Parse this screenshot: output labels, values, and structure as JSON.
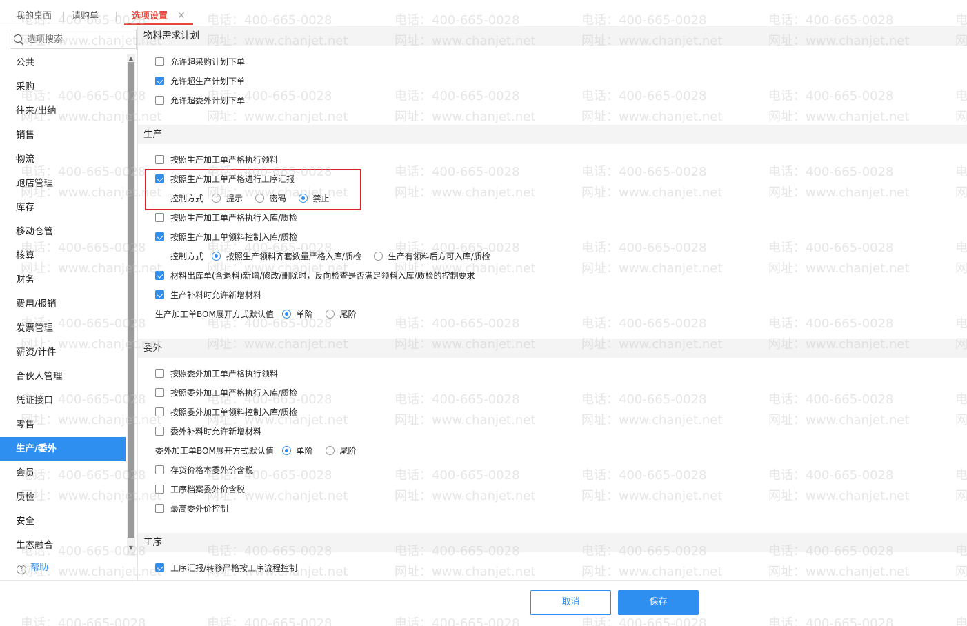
{
  "tabs": [
    {
      "label": "我的桌面"
    },
    {
      "label": "请购单"
    },
    {
      "label": "选项设置"
    }
  ],
  "colors": {
    "accent": "#2f8ff0",
    "active_tab": "#e8453c",
    "highlight_border": "#d9232c"
  },
  "sidebar": {
    "search_placeholder": "选项搜索",
    "items": [
      {
        "label": "公共"
      },
      {
        "label": "采购"
      },
      {
        "label": "往来/出纳"
      },
      {
        "label": "销售"
      },
      {
        "label": "物流"
      },
      {
        "label": "跑店管理"
      },
      {
        "label": "库存"
      },
      {
        "label": "移动仓管"
      },
      {
        "label": "核算"
      },
      {
        "label": "财务"
      },
      {
        "label": "费用/报销"
      },
      {
        "label": "发票管理"
      },
      {
        "label": "薪资/计件"
      },
      {
        "label": "合伙人管理"
      },
      {
        "label": "凭证接口"
      },
      {
        "label": "零售"
      },
      {
        "label": "生产/委外"
      },
      {
        "label": "会员"
      },
      {
        "label": "质检"
      },
      {
        "label": "安全"
      },
      {
        "label": "生态融合"
      }
    ],
    "active_item": "生产/委外",
    "help_label": "帮助"
  },
  "sections": {
    "mrp": {
      "title": "物料需求计划",
      "options": [
        {
          "label": "允许超采购计划下单",
          "checked": false
        },
        {
          "label": "允许超生产计划下单",
          "checked": true
        },
        {
          "label": "允许超委外计划下单",
          "checked": false
        }
      ]
    },
    "production": {
      "title": "生产",
      "opt1": {
        "label": "按照生产加工单严格执行领料",
        "checked": false
      },
      "opt2": {
        "label": "按照生产加工单严格进行工序汇报",
        "checked": true
      },
      "control1": {
        "label": "控制方式",
        "choices": [
          "提示",
          "密码",
          "禁止"
        ],
        "selected": "禁止"
      },
      "opt3": {
        "label": "按照生产加工单严格执行入库/质检",
        "checked": false
      },
      "opt4": {
        "label": "按照生产加工单领料控制入库/质检",
        "checked": true
      },
      "control2": {
        "label": "控制方式",
        "choices": [
          "按照生产领料齐套数量严格入库/质检",
          "生产有领料后方可入库/质检"
        ],
        "selected": "按照生产领料齐套数量严格入库/质检"
      },
      "opt5": {
        "label": "材料出库单(含退料)新增/修改/删除时，反向检查是否满足领料入库/质检的控制要求",
        "checked": true
      },
      "opt6": {
        "label": "生产补料时允许新增材料",
        "checked": true
      },
      "bom": {
        "label": "生产加工单BOM展开方式默认值",
        "choices": [
          "单阶",
          "尾阶"
        ],
        "selected": "单阶"
      }
    },
    "outsourcing": {
      "title": "委外",
      "opt1": {
        "label": "按照委外加工单严格执行领料",
        "checked": false
      },
      "opt2": {
        "label": "按照委外加工单严格执行入库/质检",
        "checked": false
      },
      "opt3": {
        "label": "按照委外加工单领料控制入库/质检",
        "checked": false
      },
      "opt4": {
        "label": "委外补料时允许新增材料",
        "checked": false
      },
      "bom": {
        "label": "委外加工单BOM展开方式默认值",
        "choices": [
          "单阶",
          "尾阶"
        ],
        "selected": "单阶"
      },
      "opt5": {
        "label": "存货价格本委外价含税",
        "checked": false
      },
      "opt6": {
        "label": "工序档案委外价含税",
        "checked": false
      },
      "opt7": {
        "label": "最高委外价控制",
        "checked": false
      }
    },
    "process": {
      "title": "工序",
      "opt1": {
        "label": "工序汇报/转移严格按工序流程控制",
        "checked": true
      }
    }
  },
  "footer": {
    "cancel_label": "取消",
    "save_label": "保存"
  },
  "watermark": {
    "line1": "电话：400-665-0028",
    "line2": "网址：www.chanjet.net"
  }
}
